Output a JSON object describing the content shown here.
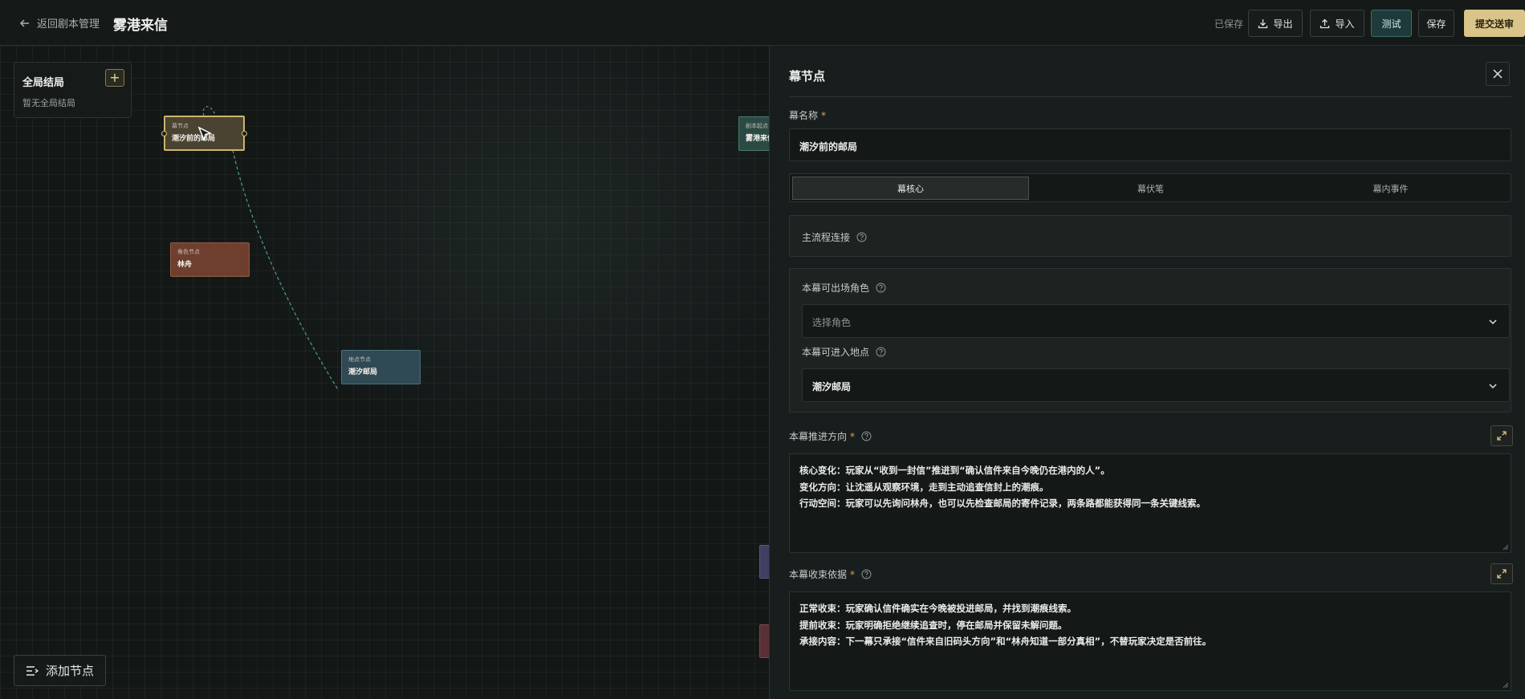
{
  "topbar": {
    "back_label": "返回剧本管理",
    "title": "雾港来信",
    "saved_status": "已保存",
    "export_label": "导出",
    "import_label": "导入",
    "test_label": "测试",
    "save_label": "保存",
    "submit_label": "提交送审"
  },
  "canvas": {
    "global_panel": {
      "title": "全局结局",
      "add_symbol": "+",
      "empty_text": "暂无全局结局"
    },
    "nodes": {
      "act": {
        "type": "幕节点",
        "name": "潮汐前的邮局"
      },
      "role": {
        "type": "角色节点",
        "name": "林舟"
      },
      "place": {
        "type": "地点节点",
        "name": "潮汐邮局"
      },
      "start": {
        "type": "剧本起点",
        "name": "雾港来信"
      }
    },
    "add_node_label": "添加节点"
  },
  "panel": {
    "title": "幕节点",
    "act_name": {
      "label": "幕名称",
      "value": "潮汐前的邮局"
    },
    "tabs": [
      "幕核心",
      "幕伏笔",
      "幕内事件"
    ],
    "main_flow_label": "主流程连接",
    "roles": {
      "label": "本幕可出场角色",
      "placeholder": "选择角色"
    },
    "places": {
      "label": "本幕可进入地点",
      "value": "潮汐邮局"
    },
    "advance": {
      "label": "本幕推进方向",
      "lines": [
        "核心变化：玩家从“收到一封信”推进到“确认信件来自今晚仍在港内的人”。",
        "变化方向：让沈遥从观察环境，走到主动追查信封上的潮痕。",
        "行动空间：玩家可以先询问林舟，也可以先检查邮局的寄件记录，两条路都能获得同一条关键线索。"
      ]
    },
    "close": {
      "label": "本幕收束依据",
      "lines": [
        "正常收束：玩家确认信件确实在今晚被投进邮局，并找到潮痕线索。",
        "提前收束：玩家明确拒绝继续追查时，停在邮局并保留未解问题。",
        "承接内容：下一幕只承接“信件来自旧码头方向”和“林舟知道一部分真相”，不替玩家决定是否前往。"
      ]
    }
  },
  "colors": {
    "accent_gold": "#d9c489",
    "test_teal": "#1f3a3a",
    "required": "#d9a34a"
  },
  "icons": [
    "arrow-left-icon",
    "download-icon",
    "upload-icon",
    "plus-icon",
    "close-icon",
    "help-icon",
    "chevron-down-icon",
    "expand-icon",
    "add-list-icon",
    "pointer-cursor-icon",
    "resize-handle-icon"
  ]
}
